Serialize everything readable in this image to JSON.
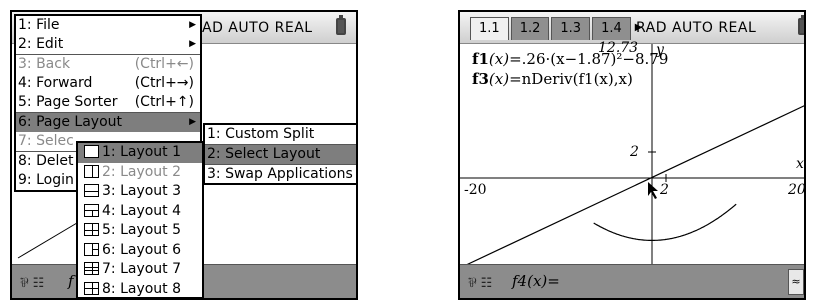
{
  "left_screen": {
    "status": "AD AUTO REAL",
    "entry_icons": "⅌ ☷",
    "entry_partial": "f",
    "main_menu": [
      {
        "label": "1: File",
        "shortcut": "",
        "arrow": true,
        "disabled": false,
        "selected": false
      },
      {
        "label": "2: Edit",
        "shortcut": "",
        "arrow": true,
        "disabled": false,
        "selected": false
      },
      {
        "label": "3: Back",
        "shortcut": "(Ctrl+←)",
        "arrow": false,
        "disabled": true,
        "selected": false
      },
      {
        "label": "4: Forward",
        "shortcut": "(Ctrl+→)",
        "arrow": false,
        "disabled": false,
        "selected": false
      },
      {
        "label": "5: Page Sorter",
        "shortcut": "(Ctrl+↑)",
        "arrow": false,
        "disabled": false,
        "selected": false
      },
      {
        "label": "6: Page Layout",
        "shortcut": "",
        "arrow": true,
        "disabled": false,
        "selected": true
      },
      {
        "label": "7: Selec",
        "shortcut": "",
        "arrow": false,
        "disabled": true,
        "selected": false
      },
      {
        "label": "8: Delet",
        "shortcut": "",
        "arrow": false,
        "disabled": false,
        "selected": false
      },
      {
        "label": "9: Login",
        "shortcut": "",
        "arrow": false,
        "disabled": false,
        "selected": false
      }
    ],
    "page_layout_menu": [
      {
        "label": "1: Custom Split",
        "arrow": false,
        "selected": false
      },
      {
        "label": "2: Select Layout",
        "arrow": true,
        "selected": true
      },
      {
        "label": "3: Swap Applications",
        "arrow": false,
        "selected": false
      }
    ],
    "layout_menu": [
      {
        "label": "1: Layout 1",
        "icon": "layout-1-icon",
        "disabled": false,
        "selected": true
      },
      {
        "label": "2: Layout 2",
        "icon": "layout-2-icon",
        "disabled": true,
        "selected": false
      },
      {
        "label": "3: Layout 3",
        "icon": "layout-3-icon",
        "disabled": false,
        "selected": false
      },
      {
        "label": "4: Layout 4",
        "icon": "layout-4-icon",
        "disabled": false,
        "selected": false
      },
      {
        "label": "5: Layout 5",
        "icon": "layout-5-icon",
        "disabled": false,
        "selected": false
      },
      {
        "label": "6: Layout 6",
        "icon": "layout-6-icon",
        "disabled": false,
        "selected": false
      },
      {
        "label": "7: Layout 7",
        "icon": "layout-7-icon",
        "disabled": false,
        "selected": false
      },
      {
        "label": "8: Layout 8",
        "icon": "layout-8-icon",
        "disabled": false,
        "selected": false
      }
    ]
  },
  "right_screen": {
    "tabs": [
      "1.1",
      "1.2",
      "1.3",
      "1.4"
    ],
    "active_tab": "1.1",
    "status": "RAD AUTO REAL",
    "f1_name": "f1",
    "f1_arg": "(x)",
    "f1_rhs": "=.26·(x−1.87)²−8.79",
    "f3_name": "f3",
    "f3_arg": "(x)",
    "f3_rhs": "=nDeriv(f1(x),x)",
    "y_max_label": "12.73",
    "y_axis_name": "y",
    "x_axis_name": "x",
    "x_min_label": "-20",
    "x_max_label": "20",
    "x_tick_label": "2",
    "y_tick_label": "2",
    "entry_icons": "⅌ ☷",
    "entry_expr": "f4(x)=",
    "scroll_icon": "≈"
  },
  "colors": {
    "selected": "#7e7e7e",
    "entry_bg": "#8c8c8c",
    "tab_inactive": "#8f8f8f",
    "tab_active": "#f0f0f0"
  }
}
